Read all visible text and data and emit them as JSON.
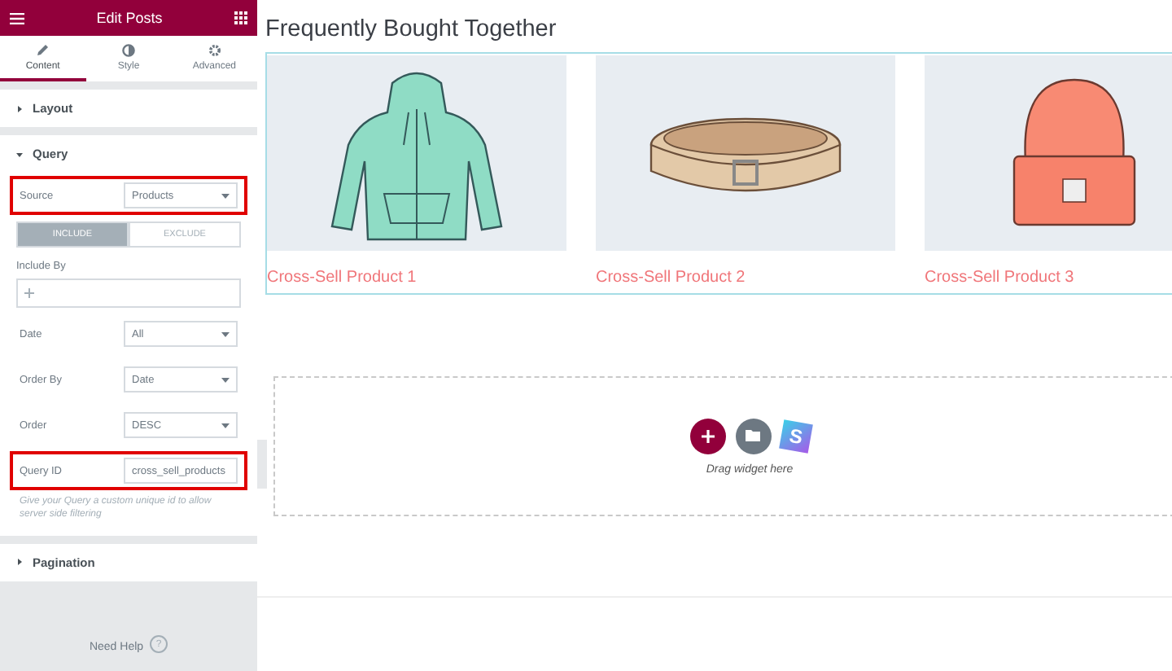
{
  "panel": {
    "title": "Edit Posts",
    "tabs": [
      {
        "label": "Content",
        "selected": true
      },
      {
        "label": "Style",
        "selected": false
      },
      {
        "label": "Advanced",
        "selected": false
      }
    ],
    "sections": [
      {
        "title": "Layout",
        "expanded": false
      },
      {
        "title": "Query",
        "expanded": true,
        "controls": [
          {
            "kind": "select",
            "label": "Source",
            "value": "Products",
            "highlighted": true
          },
          {
            "kind": "toggle",
            "options": [
              {
                "label": "INCLUDE",
                "selected": true
              },
              {
                "label": "EXCLUDE",
                "selected": false
              }
            ]
          },
          {
            "kind": "tags",
            "label": "Include By"
          },
          {
            "kind": "select",
            "label": "Date",
            "value": "All",
            "highlighted": false
          },
          {
            "kind": "select",
            "label": "Order By",
            "value": "Date",
            "highlighted": false
          },
          {
            "kind": "select",
            "label": "Order",
            "value": "DESC",
            "highlighted": false
          },
          {
            "kind": "text",
            "label": "Query ID",
            "value": "cross_sell_products",
            "highlighted": true
          },
          {
            "kind": "hint",
            "text": "Give your Query a custom unique id to allow server side filtering"
          }
        ]
      },
      {
        "title": "Pagination",
        "expanded": false
      }
    ],
    "help": {
      "label": "Need Help",
      "icon": "?"
    }
  },
  "canvas": {
    "heading": "Frequently Bought Together",
    "products": [
      {
        "name": "Cross-Sell Product 1",
        "kind": "hoodie"
      },
      {
        "name": "Cross-Sell Product 2",
        "kind": "belt"
      },
      {
        "name": "Cross-Sell Product 3",
        "kind": "beanie"
      }
    ],
    "drop_zone": {
      "text": "Drag widget here",
      "logo_text": "S"
    }
  }
}
